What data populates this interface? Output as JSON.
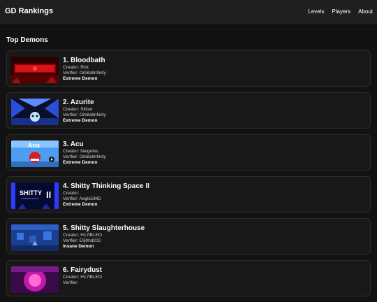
{
  "header": {
    "title": "GD Rankings",
    "nav": [
      "Levels",
      "Players",
      "About"
    ]
  },
  "section": {
    "title": "Top Demons"
  },
  "labels": {
    "creator": "Creator:",
    "verifier": "Verifier:"
  },
  "levels": [
    {
      "title": "1. Bloodbath",
      "creator": "Riot",
      "verifier": "OrbitalInfinity",
      "difficulty": "Extreme Demon"
    },
    {
      "title": "2. Azurite",
      "creator": "Sillow",
      "verifier": "OrbitalInfinity",
      "difficulty": "Extreme Demon"
    },
    {
      "title": "3. Acu",
      "creator": "Neigefeu",
      "verifier": "OrbitalInfinity",
      "difficulty": "Extreme Demon",
      "thumb_text": "Acu"
    },
    {
      "title": "4. Shitty Thinking Space II",
      "creator": "",
      "verifier": "AeglsGMD",
      "difficulty": "Extreme Demon",
      "thumb_text": "SHITTY",
      "thumb_subtext": "THINKING SPACE",
      "thumb_numeral": "II"
    },
    {
      "title": "5. Shitty Slaughterhouse",
      "creator": "H17lBLEO",
      "verifier": "Elij0hd202",
      "difficulty": "Insane Demon"
    },
    {
      "title": "6. Fairydust",
      "creator": "H17lBLEO",
      "verifier": "",
      "difficulty": ""
    }
  ]
}
